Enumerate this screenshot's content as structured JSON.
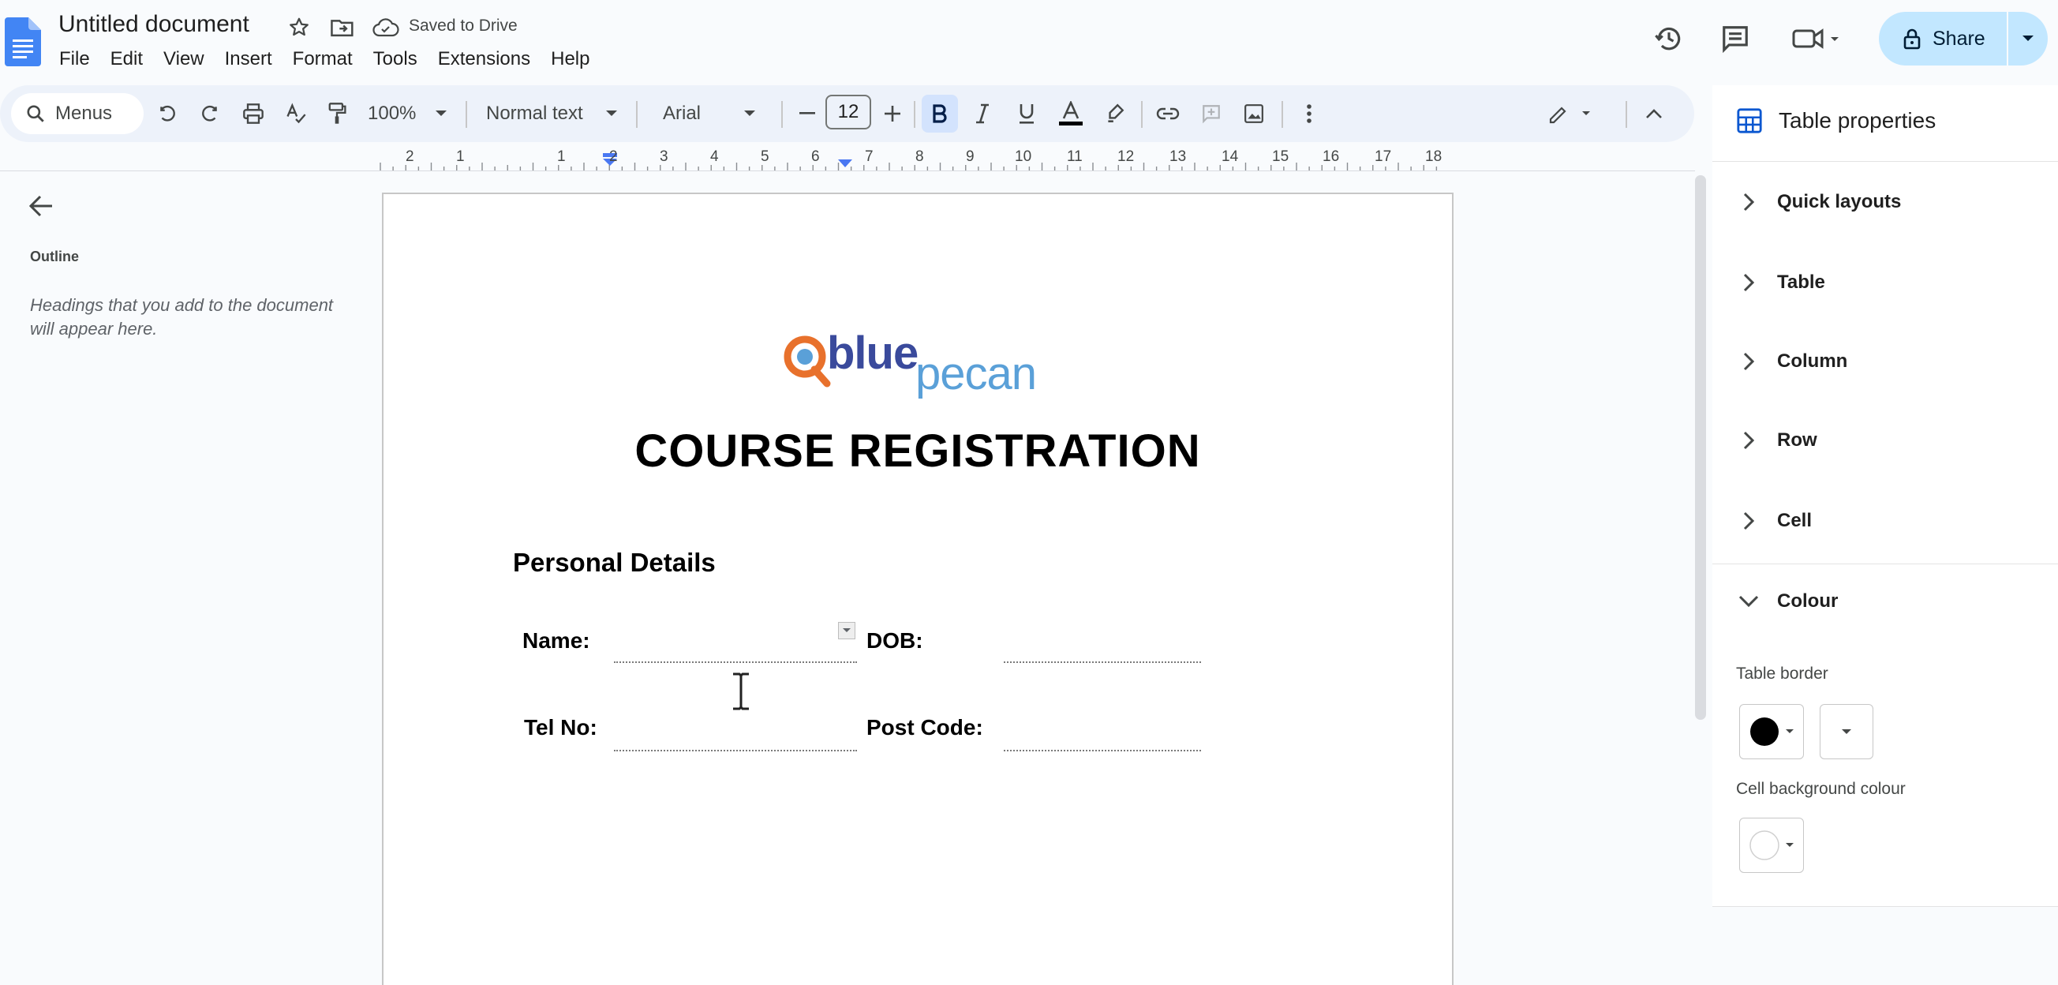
{
  "app": {
    "doc_title": "Untitled document",
    "save_status": "Saved to Drive",
    "menus": [
      "File",
      "Edit",
      "View",
      "Insert",
      "Format",
      "Tools",
      "Extensions",
      "Help"
    ],
    "share_label": "Share"
  },
  "toolbar": {
    "search_label": "Menus",
    "zoom": "100%",
    "style": "Normal text",
    "font": "Arial",
    "font_size": "12",
    "text_color": "#000000"
  },
  "ruler": [
    "2",
    "1",
    "1",
    "2",
    "3",
    "4",
    "5",
    "6",
    "7",
    "8",
    "9",
    "10",
    "11",
    "12",
    "13",
    "14",
    "15",
    "16",
    "17",
    "18"
  ],
  "outline": {
    "title": "Outline",
    "hint": "Headings that you add to the document will appear here."
  },
  "document": {
    "logo": {
      "blue": "blue",
      "pecan": "pecan"
    },
    "heading": "COURSE REGISTRATION",
    "subheading": "Personal Details",
    "fields": {
      "name": "Name:",
      "dob": "DOB:",
      "tel": "Tel No:",
      "postcode": "Post Code:"
    }
  },
  "panel": {
    "title": "Table properties",
    "sections": [
      "Quick layouts",
      "Table",
      "Column",
      "Row",
      "Cell",
      "Colour"
    ],
    "table_border_label": "Table border",
    "cell_background_label": "Cell background colour",
    "border_color": "#000000",
    "cell_background_color": "#ffffff"
  },
  "colors": {
    "accent": "#0b57d0",
    "share_bg": "#c2e7ff",
    "bold_active_bg": "#d3e3fd",
    "doc_icon": "#4285f4"
  }
}
